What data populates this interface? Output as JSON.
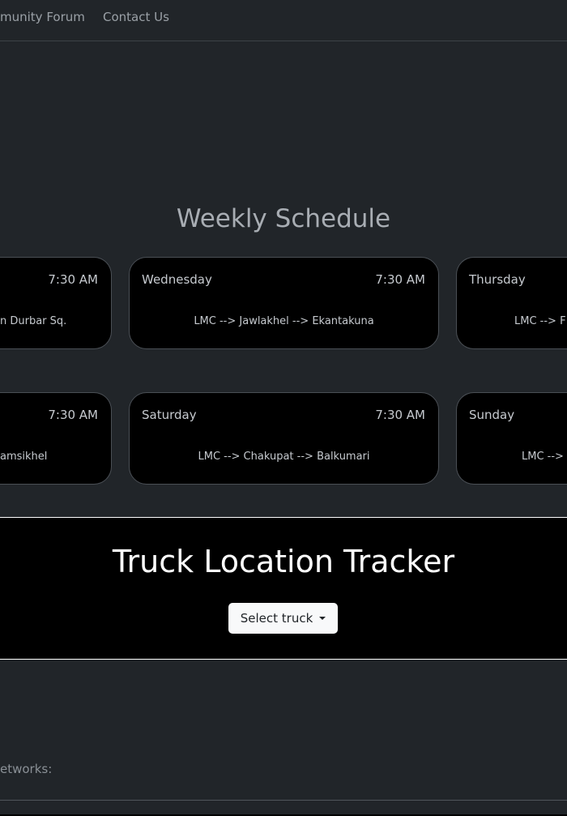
{
  "nav": {
    "items": [
      "munity Forum",
      "Contact Us"
    ]
  },
  "schedule": {
    "title": "Weekly Schedule",
    "row1": [
      {
        "day": "",
        "time": "7:30 AM",
        "route": "n Durbar Sq."
      },
      {
        "day": "Wednesday",
        "time": "7:30 AM",
        "route": "LMC --> Jawlakhel --> Ekantakuna"
      },
      {
        "day": "Thursday",
        "time": "",
        "route": "LMC --> F"
      }
    ],
    "row2": [
      {
        "day": "",
        "time": "7:30 AM",
        "route": "amsikhel"
      },
      {
        "day": "Saturday",
        "time": "7:30 AM",
        "route": "LMC --> Chakupat --> Balkumari"
      },
      {
        "day": "Sunday",
        "time": "",
        "route": "LMC -->"
      }
    ]
  },
  "tracker": {
    "title": "Truck Location Tracker",
    "select_label": "Select truck"
  },
  "footer": {
    "networks_label": "etworks:"
  }
}
